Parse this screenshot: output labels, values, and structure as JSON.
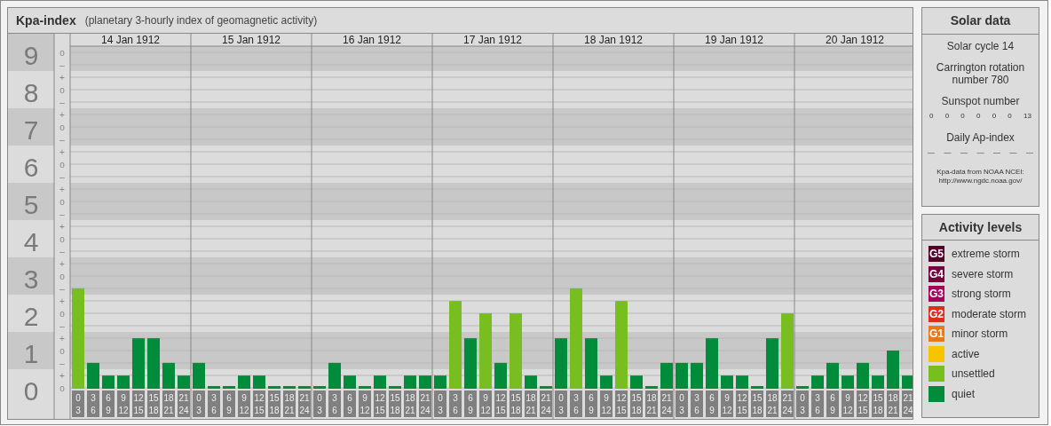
{
  "title": "Kpa-index",
  "subtitle": "(planetary 3-hourly index of geomagnetic activity)",
  "chart": {
    "days": [
      {
        "date": "14 Jan 1912",
        "periods": [
          [
            "0",
            "3"
          ],
          [
            "3",
            "6"
          ],
          [
            "6",
            "9"
          ],
          [
            "9",
            "12"
          ],
          [
            "12",
            "15"
          ],
          [
            "15",
            "18"
          ],
          [
            "18",
            "21"
          ],
          [
            "21",
            "24"
          ]
        ]
      },
      {
        "date": "15 Jan 1912",
        "periods": [
          [
            "0",
            "3"
          ],
          [
            "3",
            "6"
          ],
          [
            "6",
            "9"
          ],
          [
            "9",
            "12"
          ],
          [
            "12",
            "15"
          ],
          [
            "15",
            "18"
          ],
          [
            "18",
            "21"
          ],
          [
            "21",
            "24"
          ]
        ]
      },
      {
        "date": "16 Jan 1912",
        "periods": [
          [
            "0",
            "3"
          ],
          [
            "3",
            "6"
          ],
          [
            "6",
            "9"
          ],
          [
            "9",
            "12"
          ],
          [
            "12",
            "15"
          ],
          [
            "15",
            "18"
          ],
          [
            "18",
            "21"
          ],
          [
            "21",
            "24"
          ]
        ]
      },
      {
        "date": "17 Jan 1912",
        "periods": [
          [
            "0",
            "3"
          ],
          [
            "3",
            "6"
          ],
          [
            "6",
            "9"
          ],
          [
            "9",
            "12"
          ],
          [
            "12",
            "15"
          ],
          [
            "15",
            "18"
          ],
          [
            "18",
            "21"
          ],
          [
            "21",
            "24"
          ]
        ]
      },
      {
        "date": "18 Jan 1912",
        "periods": [
          [
            "0",
            "3"
          ],
          [
            "3",
            "6"
          ],
          [
            "6",
            "9"
          ],
          [
            "9",
            "12"
          ],
          [
            "12",
            "15"
          ],
          [
            "15",
            "18"
          ],
          [
            "18",
            "21"
          ],
          [
            "21",
            "24"
          ]
        ]
      },
      {
        "date": "19 Jan 1912",
        "periods": [
          [
            "0",
            "3"
          ],
          [
            "3",
            "6"
          ],
          [
            "6",
            "9"
          ],
          [
            "9",
            "12"
          ],
          [
            "12",
            "15"
          ],
          [
            "15",
            "18"
          ],
          [
            "18",
            "21"
          ],
          [
            "21",
            "24"
          ]
        ]
      },
      {
        "date": "20 Jan 1912",
        "periods": [
          [
            "0",
            "3"
          ],
          [
            "3",
            "6"
          ],
          [
            "6",
            "9"
          ],
          [
            "9",
            "12"
          ],
          [
            "12",
            "15"
          ],
          [
            "15",
            "18"
          ],
          [
            "18",
            "21"
          ],
          [
            "21",
            "24"
          ]
        ]
      }
    ],
    "sub_tick_labels": [
      "o",
      "–",
      "+",
      "o",
      "–",
      "+",
      "o",
      "–",
      "+",
      "o",
      "–",
      "+",
      "o",
      "–",
      "+",
      "o",
      "–",
      "+",
      "o",
      "–",
      "+",
      "o",
      "–",
      "+",
      "o",
      "–",
      "+",
      "o"
    ],
    "chart_data": {
      "type": "bar",
      "grid": true,
      "ylim": [
        0,
        9.5
      ],
      "yticks": [
        0,
        1,
        2,
        3,
        4,
        5,
        6,
        7,
        8,
        9
      ],
      "series": [
        {
          "color": "#008c3a",
          "values": [
            null,
            0.67,
            0.33,
            0.33,
            1.33,
            1.33,
            0.67,
            0.33,
            0.67,
            0,
            0,
            0.33,
            0.33,
            0,
            0,
            0,
            0,
            0.67,
            0.33,
            0,
            0.33,
            0,
            0.33,
            0.33,
            0.33,
            null,
            1.33,
            null,
            0.67,
            null,
            0.33,
            0,
            1.33,
            null,
            1.33,
            0.33,
            null,
            0.33,
            0,
            0.67,
            0.67,
            0.67,
            1.33,
            0.33,
            0.33,
            0,
            1.33,
            null,
            0,
            0.33,
            0.67,
            0.33,
            0.67,
            0.33,
            1,
            0.33
          ]
        },
        {
          "color": "#78be20",
          "values": [
            2.67,
            null,
            null,
            null,
            null,
            null,
            null,
            null,
            null,
            null,
            null,
            null,
            null,
            null,
            null,
            null,
            null,
            null,
            null,
            null,
            null,
            null,
            null,
            null,
            null,
            2.33,
            null,
            2,
            null,
            2,
            null,
            null,
            null,
            2.67,
            null,
            null,
            2.33,
            null,
            null,
            null,
            null,
            null,
            null,
            null,
            null,
            null,
            null,
            2,
            null,
            null,
            null,
            null,
            null,
            null,
            null,
            null
          ]
        }
      ]
    }
  },
  "solar_data": {
    "title": "Solar data",
    "solar_cycle": "Solar cycle 14",
    "carrington": "Carrington rotation number 780",
    "sunspot_label": "Sunspot number",
    "sunspot_numbers": [
      "0",
      "0",
      "0",
      "0",
      "0",
      "0",
      "13"
    ],
    "ap_label": "Daily Ap-index",
    "ap_values": [
      "—",
      "—",
      "—",
      "—",
      "—",
      "—",
      "—"
    ],
    "source": "Kpa-data from NOAA NCEI:",
    "source_url": "http://www.ngdc.noaa.gov/"
  },
  "activity_levels": {
    "title": "Activity levels",
    "items": [
      {
        "badge": "G5",
        "label": "extreme storm",
        "color": "#52002a"
      },
      {
        "badge": "G4",
        "label": "severe storm",
        "color": "#78003f"
      },
      {
        "badge": "G3",
        "label": "strong storm",
        "color": "#a8005a"
      },
      {
        "badge": "G2",
        "label": "moderate storm",
        "color": "#d9301c"
      },
      {
        "badge": "G1",
        "label": "minor storm",
        "color": "#e8791a"
      },
      {
        "label": "active",
        "color": "#f8c300"
      },
      {
        "label": "unsettled",
        "color": "#78be20"
      },
      {
        "label": "quiet",
        "color": "#008c3a"
      }
    ]
  }
}
